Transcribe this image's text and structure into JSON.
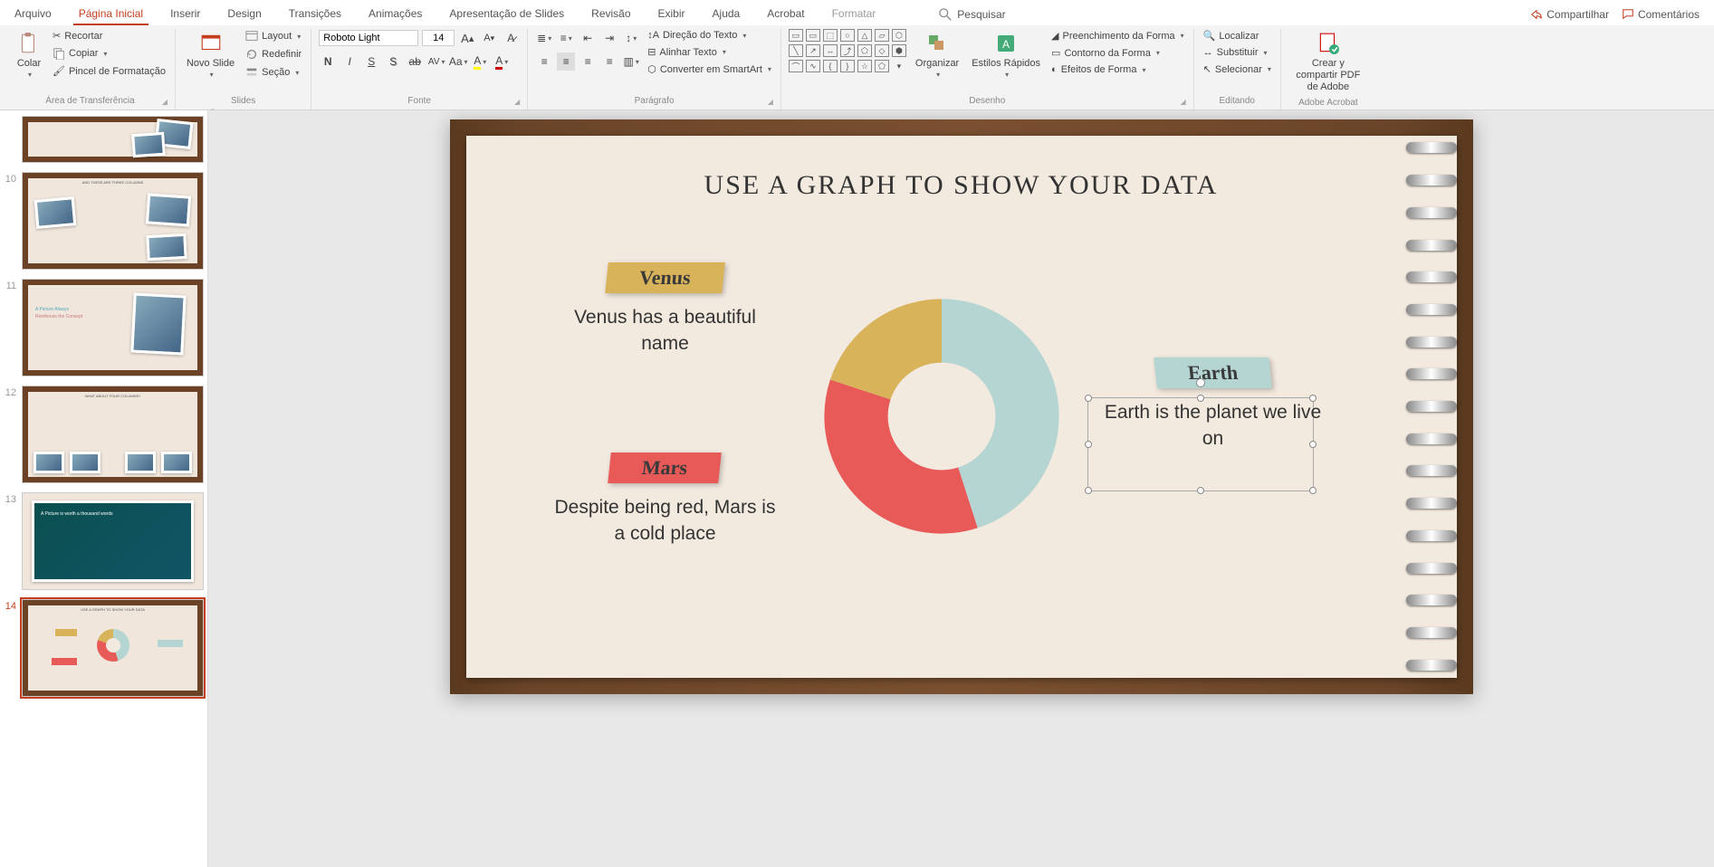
{
  "menu": {
    "items": [
      "Arquivo",
      "Página Inicial",
      "Inserir",
      "Design",
      "Transições",
      "Animações",
      "Apresentação de Slides",
      "Revisão",
      "Exibir",
      "Ajuda",
      "Acrobat"
    ],
    "format": "Formatar",
    "search": "Pesquisar",
    "share": "Compartilhar",
    "comments": "Comentários"
  },
  "ribbon": {
    "clipboard": {
      "paste": "Colar",
      "cut": "Recortar",
      "copy": "Copiar",
      "painter": "Pincel de Formatação",
      "label": "Área de Transferência"
    },
    "slides": {
      "new": "Novo Slide",
      "layout": "Layout",
      "reset": "Redefinir",
      "section": "Seção",
      "label": "Slides"
    },
    "font": {
      "name": "Roboto Light",
      "size": "14",
      "label": "Fonte"
    },
    "paragraph": {
      "dir": "Direção do Texto",
      "align": "Alinhar Texto",
      "smart": "Converter em SmartArt",
      "label": "Parágrafo"
    },
    "drawing": {
      "arrange": "Organizar",
      "styles": "Estilos Rápidos",
      "fill": "Preenchimento da Forma",
      "outline": "Contorno da Forma",
      "effects": "Efeitos de Forma",
      "label": "Desenho"
    },
    "editing": {
      "find": "Localizar",
      "replace": "Substituir",
      "select": "Selecionar",
      "label": "Editando"
    },
    "adobe": {
      "share": "Crear y compartir PDF de Adobe",
      "label": "Adobe Acrobat"
    }
  },
  "thumbs": {
    "start": 9,
    "labels": {
      "t10": "AND THESE ARE THREE COLUMNS",
      "t11a": "A Picture Always",
      "t11b": "Reinforces the Concept",
      "t12": "WHAT ABOUT FOUR COLUMNS?",
      "t13": "A Picture is worth a thousand words",
      "t14": "USE A GRAPH TO SHOW YOUR DATA"
    }
  },
  "slide": {
    "title": "USE A GRAPH TO SHOW YOUR DATA",
    "venus": {
      "label": "Venus",
      "caption": "Venus has a beautiful name"
    },
    "mars": {
      "label": "Mars",
      "caption": "Despite being red, Mars is a cold place"
    },
    "earth": {
      "label": "Earth",
      "caption": "Earth is the planet we live on"
    }
  },
  "colors": {
    "teal": "#b4d5d2",
    "red": "#e85a58",
    "yellow": "#d9b35a"
  },
  "chart_data": {
    "type": "pie",
    "title": "USE A GRAPH TO SHOW YOUR DATA",
    "categories": [
      "Earth",
      "Mars",
      "Venus"
    ],
    "values": [
      45,
      35,
      20
    ],
    "colors": [
      "#b4d5d2",
      "#e85a58",
      "#d9b35a"
    ]
  }
}
